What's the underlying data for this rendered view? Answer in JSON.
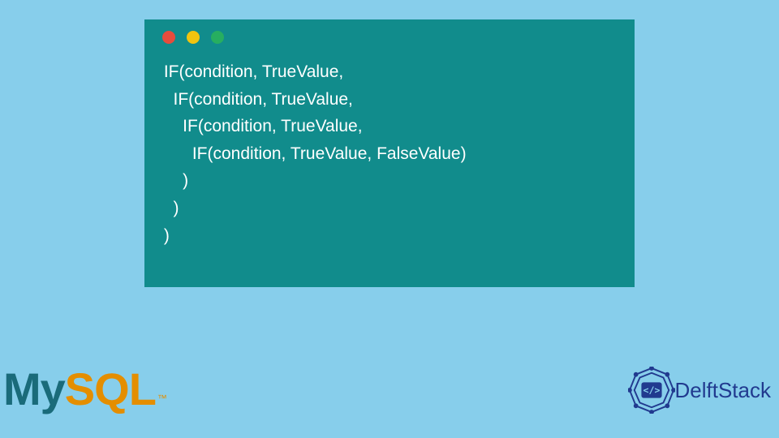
{
  "code": {
    "lines": [
      " IF(condition, TrueValue,",
      "   IF(condition, TrueValue,",
      "     IF(condition, TrueValue,",
      "       IF(condition, TrueValue, FalseValue)",
      "     )",
      "   )",
      " )"
    ]
  },
  "logos": {
    "mysql": {
      "part1": "My",
      "part2": "SQL",
      "tm": "™"
    },
    "delftstack": {
      "text": "DelftStack",
      "badge_symbol": "</>"
    }
  },
  "window": {
    "dots": [
      "red",
      "yellow",
      "green"
    ]
  }
}
